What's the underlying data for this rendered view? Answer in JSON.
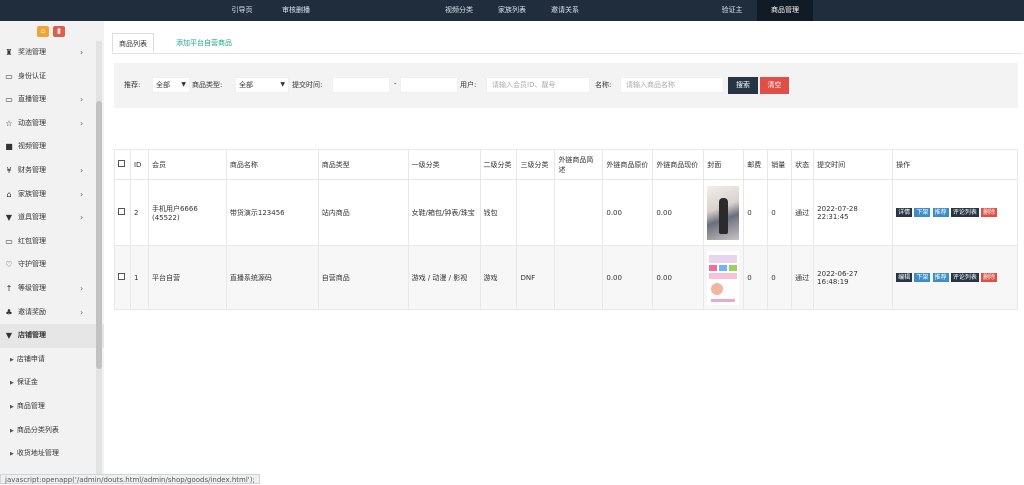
{
  "topnav": {
    "items": [
      {
        "label": "引导页"
      },
      {
        "label": "审核删播"
      },
      {
        "label": "视频分类"
      },
      {
        "label": "家族列表"
      },
      {
        "label": "邀请关系"
      },
      {
        "label": "验证主"
      },
      {
        "label": "商品管理",
        "active": true
      }
    ]
  },
  "sidebar": {
    "items": [
      {
        "label": "奖池管理",
        "icon": "trophy-icon",
        "chevron": true
      },
      {
        "label": "身份认证",
        "icon": "monitor-icon",
        "chevron": false
      },
      {
        "label": "直播管理",
        "icon": "monitor-icon",
        "chevron": true
      },
      {
        "label": "动态管理",
        "icon": "star-icon",
        "chevron": true
      },
      {
        "label": "视频管理",
        "icon": "video-camera-icon",
        "chevron": false
      },
      {
        "label": "财务管理",
        "icon": "yen-icon",
        "chevron": true
      },
      {
        "label": "家族管理",
        "icon": "bank-icon",
        "chevron": true
      },
      {
        "label": "道具管理",
        "icon": "cart-icon",
        "chevron": true
      },
      {
        "label": "红包管理",
        "icon": "envelope-icon",
        "chevron": false
      },
      {
        "label": "守护管理",
        "icon": "heart-icon",
        "chevron": false
      },
      {
        "label": "等级管理",
        "icon": "level-up-icon",
        "chevron": true
      },
      {
        "label": "邀请奖励",
        "icon": "sitemap-icon",
        "chevron": true
      },
      {
        "label": "店铺管理",
        "icon": "cart-icon",
        "chevron": false,
        "active": true
      }
    ],
    "subitems": [
      {
        "label": "店铺申请"
      },
      {
        "label": "保证金"
      },
      {
        "label": "商品管理"
      },
      {
        "label": "商品分类列表"
      },
      {
        "label": "收货地址管理"
      }
    ]
  },
  "tabs": {
    "active": "商品列表",
    "add": "添加平台自营商品"
  },
  "filter": {
    "recommend_label": "推荐:",
    "recommend_value": "全部",
    "type_label": "商品类型:",
    "type_value": "全部",
    "time_label": "提交时间:",
    "time_sep": "-",
    "user_label": "用户:",
    "user_placeholder": "请输入会员ID、靓号",
    "name_label": "名称:",
    "name_placeholder": "请输入商品名称",
    "search_btn": "搜索",
    "clear_btn": "清空"
  },
  "table": {
    "headers": [
      "ID",
      "会员",
      "商品名称",
      "商品类型",
      "一级分类",
      "二级分类",
      "三级分类",
      "外链商品简述",
      "外链商品原价",
      "外链商品现价",
      "封面",
      "邮费",
      "销量",
      "状态",
      "提交时间",
      "操作"
    ],
    "rows": [
      {
        "id": "2",
        "member": "手机用户6666 (45522)",
        "name": "带货演示123456",
        "type": "站内商品",
        "cat1": "女鞋/箱包/钟表/珠宝",
        "cat2": "钱包",
        "cat3": "",
        "brief": "",
        "orig_price": "0.00",
        "cur_price": "0.00",
        "postage": "0",
        "sales": "0",
        "status": "通过",
        "time": "2022-07-28 22:31:45",
        "ops": [
          "详情",
          "下架",
          "推荐",
          "评论列表",
          "删除"
        ]
      },
      {
        "id": "1",
        "member": "平台自营",
        "name": "直播系统源码",
        "type": "自营商品",
        "cat1": "游戏 / 动漫 / 影视",
        "cat2": "游戏",
        "cat3": "DNF",
        "brief": "",
        "orig_price": "0.00",
        "cur_price": "0.00",
        "postage": "0",
        "sales": "0",
        "status": "通过",
        "time": "2022-06-27 16:48:19",
        "ops": [
          "编辑",
          "下架",
          "推荐",
          "评论列表",
          "删除"
        ]
      }
    ]
  },
  "status_bar": {
    "url": "javascript:openapp('/admin/douts.html/admin/shop/goods/index.html');"
  },
  "colors": {
    "topnav_bg": "#1f2d3d",
    "accent_green": "#18a689",
    "btn_dark": "#273444",
    "btn_blue": "#3c8dcb",
    "btn_red": "#e04f45"
  }
}
